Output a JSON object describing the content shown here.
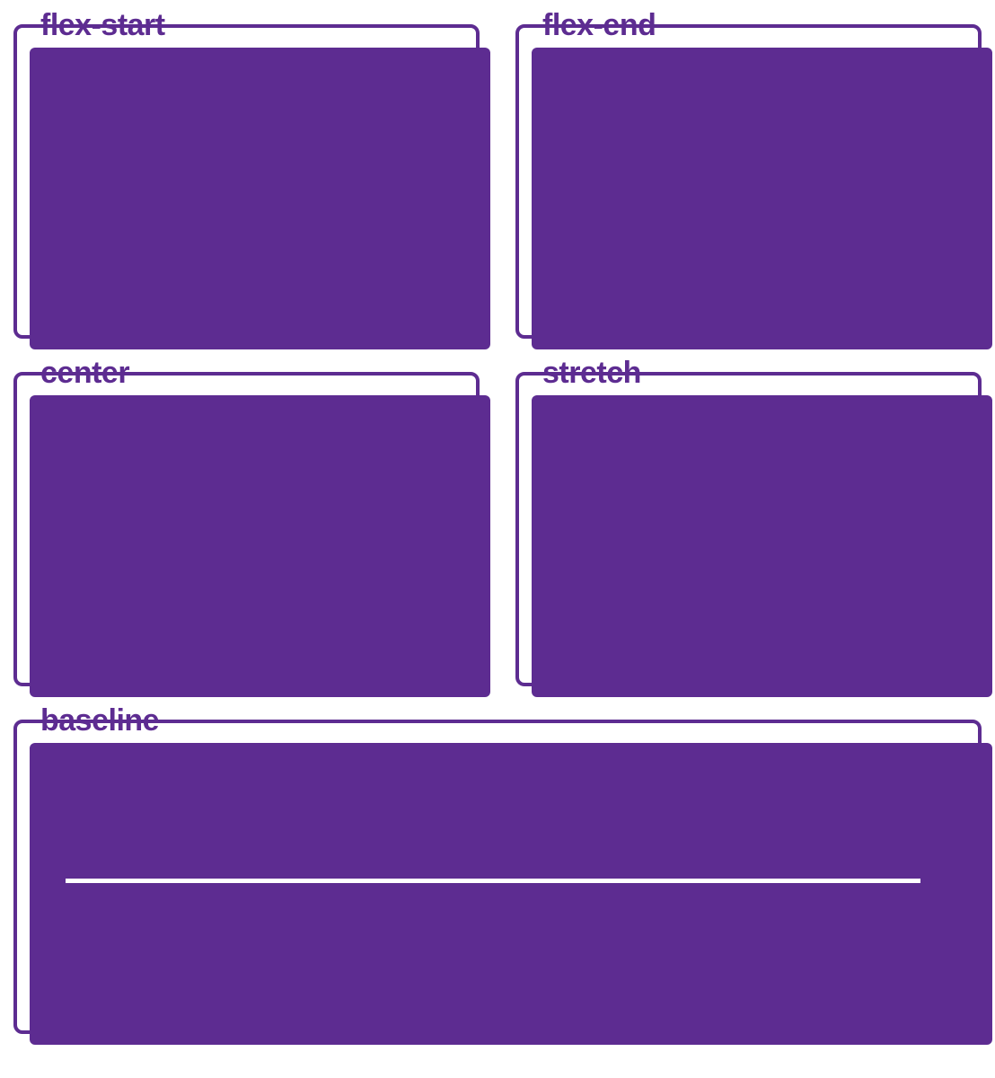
{
  "diagram": {
    "items": [
      {
        "label": "flex-start"
      },
      {
        "label": "flex-end"
      },
      {
        "label": "center"
      },
      {
        "label": "stretch"
      },
      {
        "label": "baseline"
      }
    ]
  },
  "colors": {
    "purple": "#5d2c91",
    "line": "#ffffff"
  }
}
